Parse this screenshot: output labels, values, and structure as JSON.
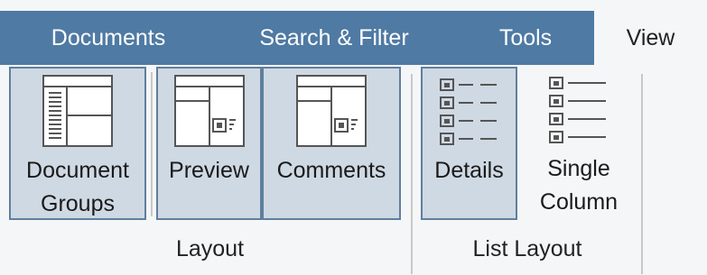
{
  "tabs": [
    {
      "label": "Documents",
      "active": false
    },
    {
      "label": "Search & Filter",
      "active": false
    },
    {
      "label": "Tools",
      "active": false
    },
    {
      "label": "View",
      "active": true
    }
  ],
  "ribbon": {
    "layout_group": {
      "label": "Layout",
      "buttons": {
        "document_groups": {
          "line1": "Document",
          "line2": "Groups",
          "selected": true
        },
        "preview": {
          "label": "Preview",
          "selected": true
        },
        "comments": {
          "label": "Comments",
          "selected": true
        }
      }
    },
    "list_layout_group": {
      "label": "List Layout",
      "buttons": {
        "details": {
          "label": "Details",
          "selected": true
        },
        "single_column": {
          "line1": "Single",
          "line2": "Column",
          "selected": false
        }
      }
    }
  },
  "colors": {
    "tab_bar": "#4f7aa3",
    "selected_fill": "#cfd9e3",
    "selected_border": "#5f7f9e",
    "background": "#f5f6f7"
  }
}
